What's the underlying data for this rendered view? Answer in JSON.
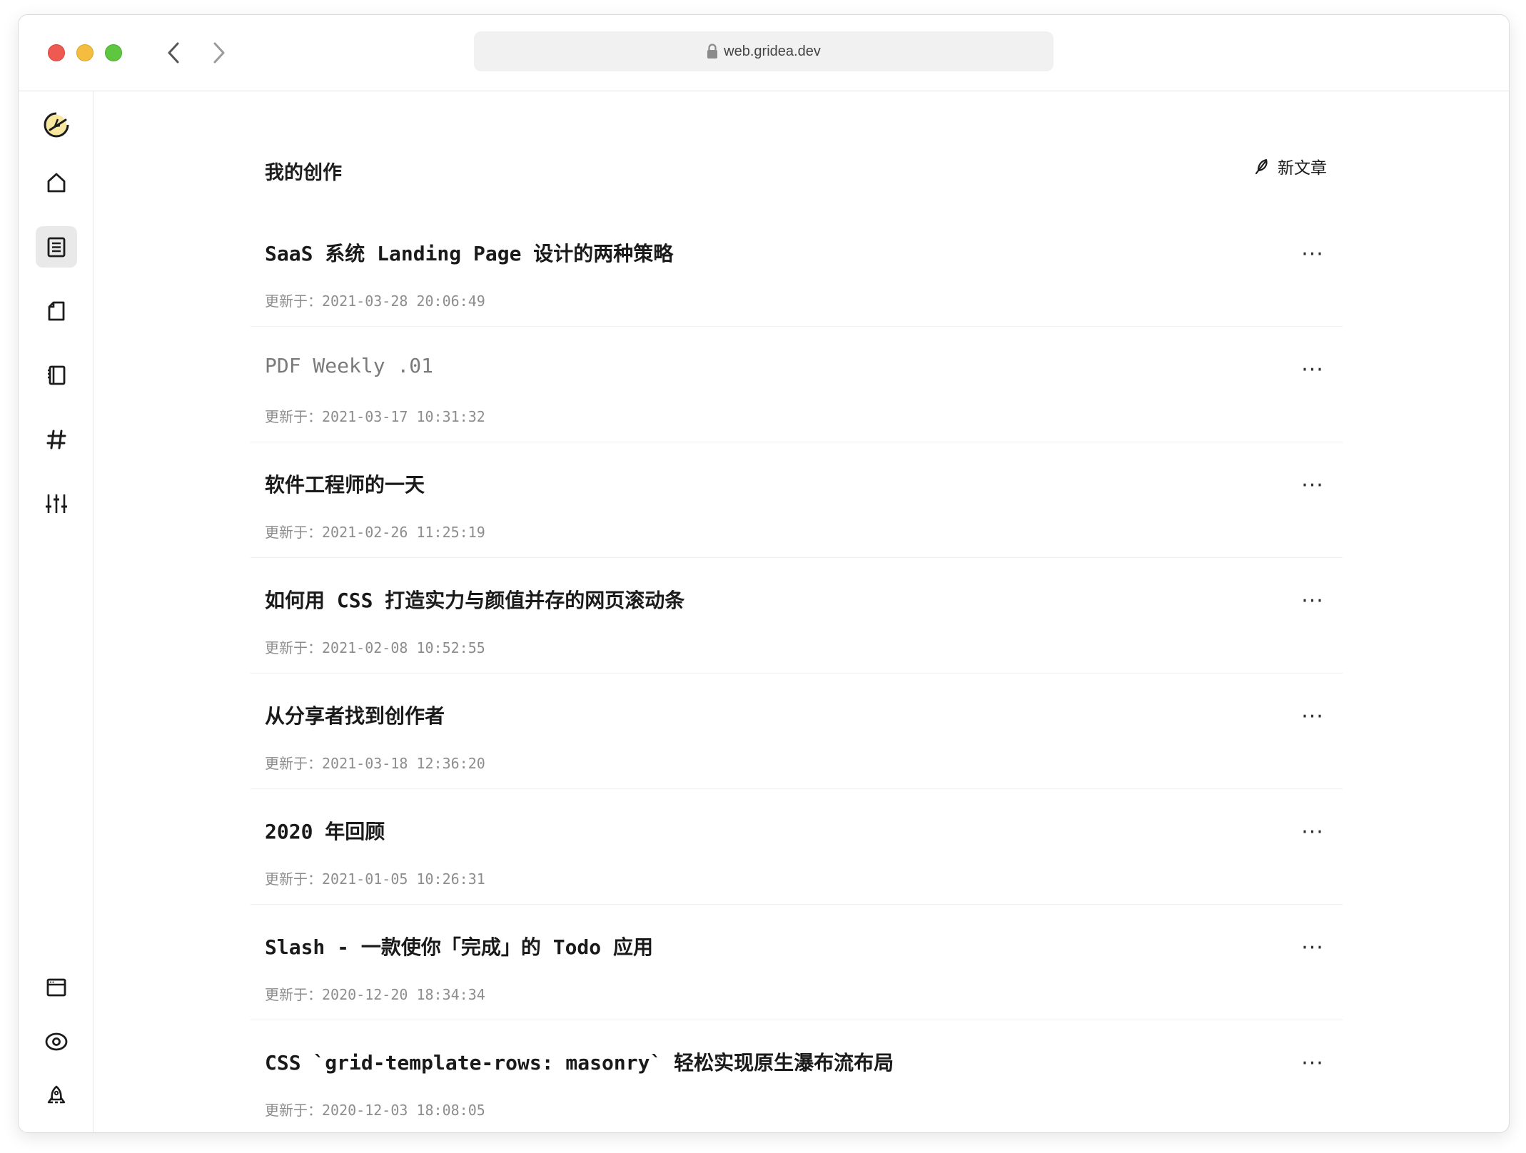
{
  "browser": {
    "url": "web.gridea.dev"
  },
  "sidebar": {
    "items": [
      {
        "name": "logo-icon"
      },
      {
        "name": "home-icon"
      },
      {
        "name": "posts-icon"
      },
      {
        "name": "pages-icon"
      },
      {
        "name": "menu-icon"
      },
      {
        "name": "tags-icon"
      },
      {
        "name": "settings-icon"
      },
      {
        "name": "theme-icon"
      },
      {
        "name": "preview-icon"
      },
      {
        "name": "publish-icon"
      }
    ]
  },
  "header": {
    "title": "我的创作",
    "new_post_label": "新文章"
  },
  "posts": [
    {
      "title": "SaaS 系统 Landing Page 设计的两种策略",
      "meta": "更新于：2021-03-28 20:06:49",
      "draft": false
    },
    {
      "title": "PDF Weekly .01",
      "meta": "更新于：2021-03-17 10:31:32",
      "draft": true
    },
    {
      "title": "软件工程师的一天",
      "meta": "更新于：2021-02-26 11:25:19",
      "draft": false
    },
    {
      "title": "如何用 CSS 打造实力与颜值并存的网页滚动条",
      "meta": "更新于：2021-02-08 10:52:55",
      "draft": false
    },
    {
      "title": "从分享者找到创作者",
      "meta": "更新于：2021-03-18 12:36:20",
      "draft": false
    },
    {
      "title": "2020 年回顾",
      "meta": "更新于：2021-01-05 10:26:31",
      "draft": false
    },
    {
      "title": "Slash - 一款使你「完成」的 Todo 应用",
      "meta": "更新于：2020-12-20 18:34:34",
      "draft": false
    },
    {
      "title": "CSS `grid-template-rows: masonry` 轻松实现原生瀑布流布局",
      "meta": "更新于：2020-12-03 18:08:05",
      "draft": false
    }
  ],
  "more_label": "···",
  "colors": {
    "close": "#ee5a52",
    "minimize": "#f5bd3f",
    "zoom": "#5fc63f",
    "logo_fill": "#f7e7a0",
    "active_bg": "#e9e9e9"
  }
}
